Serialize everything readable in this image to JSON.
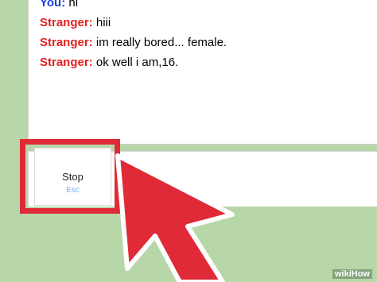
{
  "chat": {
    "messages": [
      {
        "speaker": "You:",
        "text": " hi",
        "role": "you"
      },
      {
        "speaker": "Stranger:",
        "text": " hiii",
        "role": "stranger"
      },
      {
        "speaker": "Stranger:",
        "text": " im really bored... female.",
        "role": "stranger"
      },
      {
        "speaker": "Stranger:",
        "text": " ok well i am,16.",
        "role": "stranger"
      }
    ]
  },
  "controls": {
    "stop_label": "Stop",
    "stop_shortcut": "Esc"
  },
  "watermark": {
    "text": "wikiHow"
  },
  "colors": {
    "background": "#b7d7a8",
    "you_color": "#1a3fd8",
    "stranger_color": "#e22020",
    "highlight": "#e02a37",
    "esc_hint": "#7aaedb"
  },
  "icons": {
    "pointer": "arrow-pointer-icon"
  }
}
